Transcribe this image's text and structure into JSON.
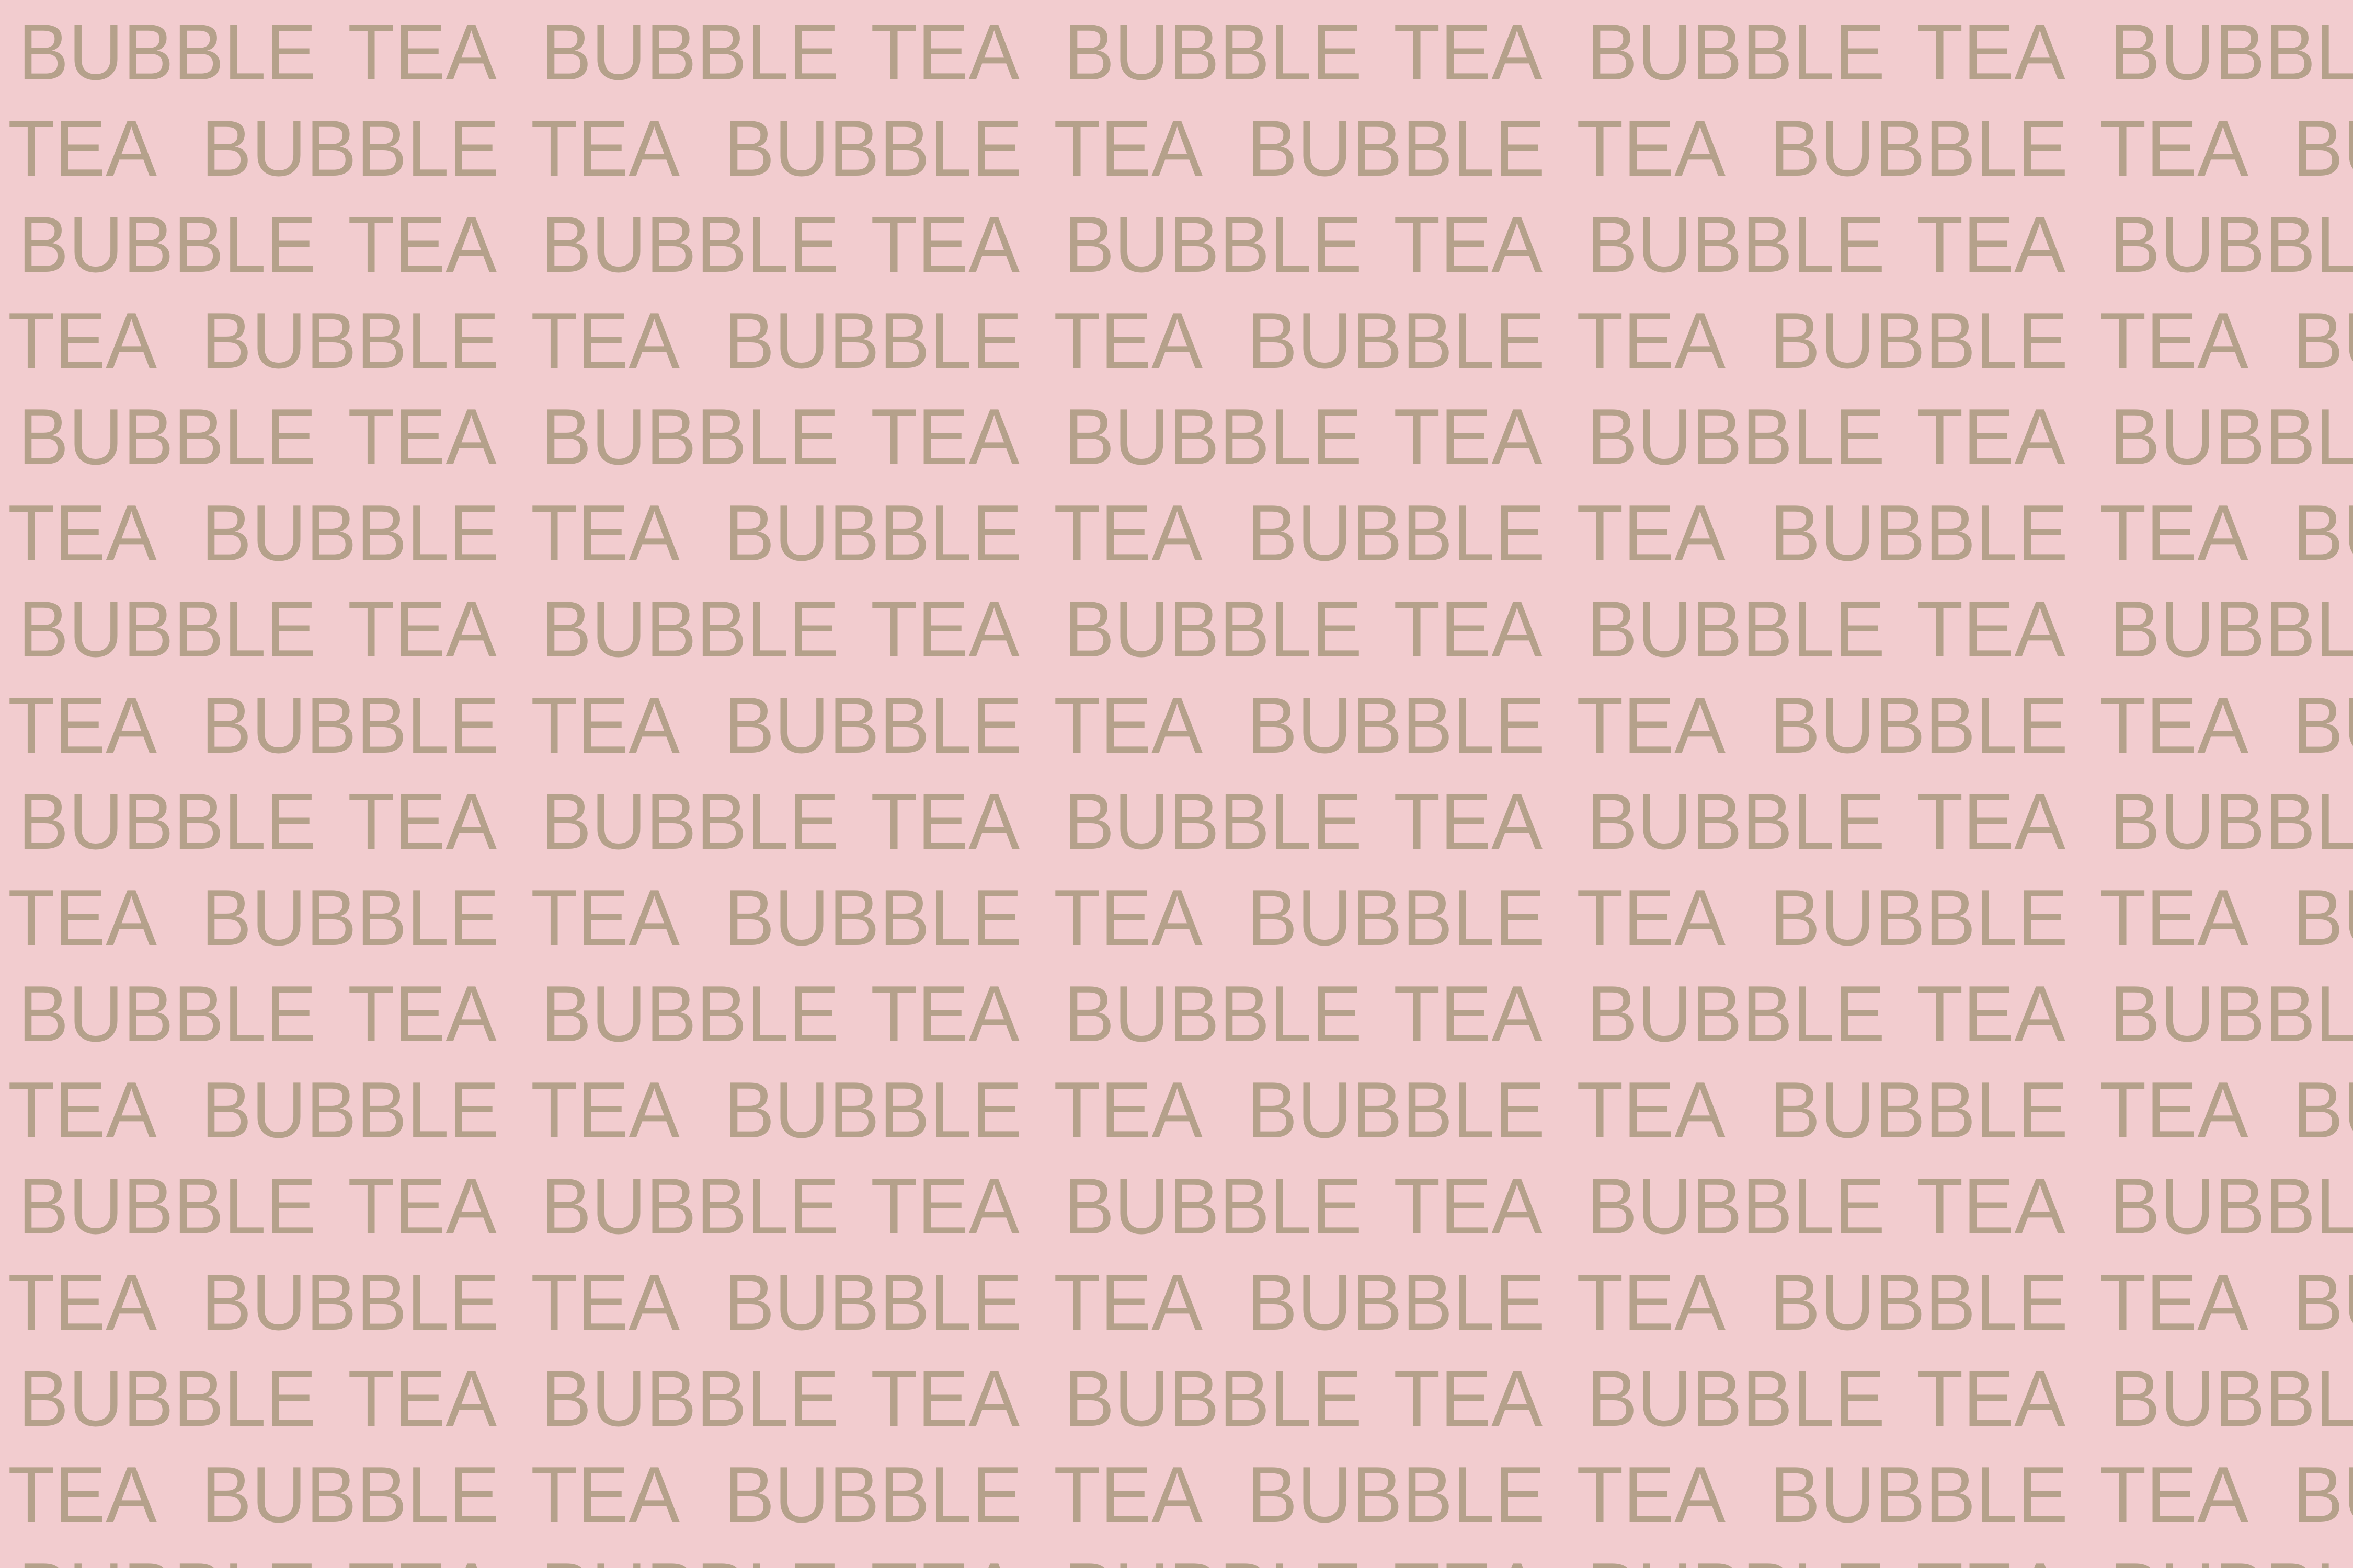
{
  "pattern": {
    "word1": "BUBBLE",
    "word2": "TEA",
    "text_color": "#B5A18B",
    "background_color": "#F2CCCF"
  }
}
